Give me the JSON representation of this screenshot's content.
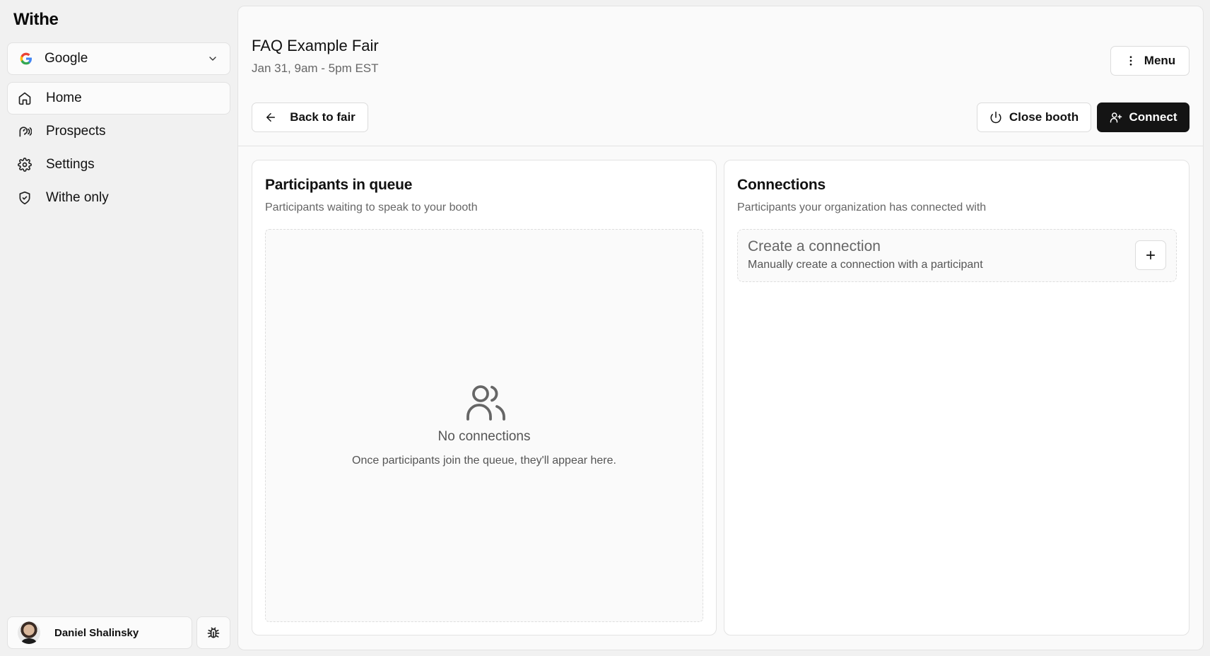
{
  "app": {
    "brand": "Withe"
  },
  "sidebar": {
    "org_selector": {
      "name": "Google",
      "icon": "google-logo-icon"
    },
    "items": [
      {
        "label": "Home",
        "icon": "home-icon",
        "active": true
      },
      {
        "label": "Prospects",
        "icon": "prospects-icon",
        "active": false
      },
      {
        "label": "Settings",
        "icon": "gear-icon",
        "active": false
      },
      {
        "label": "Withe only",
        "icon": "shield-icon",
        "active": false
      }
    ],
    "user": {
      "name": "Daniel Shalinsky"
    },
    "bug_icon": "bug-icon"
  },
  "header": {
    "title": "FAQ Example Fair",
    "subtitle": "Jan 31, 9am - 5pm EST",
    "menu_label": "Menu",
    "back_label": "Back to fair",
    "close_label": "Close booth",
    "connect_label": "Connect"
  },
  "queue": {
    "title": "Participants in queue",
    "subtitle": "Participants waiting to speak to your booth",
    "empty_title": "No connections",
    "empty_text": "Once participants join the queue, they'll appear here."
  },
  "connections": {
    "title": "Connections",
    "subtitle": "Participants your organization has connected with",
    "create_title": "Create a connection",
    "create_sub": "Manually create a connection with a participant"
  },
  "colors": {
    "primary_button": "#141414",
    "muted_text": "#666666",
    "border": "#e3e3e3"
  }
}
